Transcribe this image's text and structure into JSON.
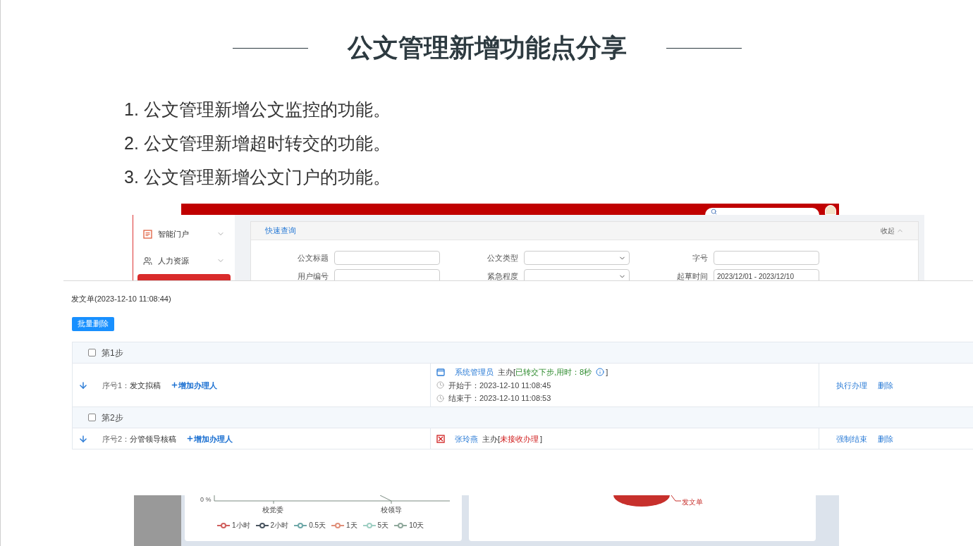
{
  "slide": {
    "title": "公文管理新增功能点分享",
    "points": [
      "1. 公文管理新增公文监控的功能。",
      "2. 公文管理新增超时转交的功能。",
      "3. 公文管理新增公文门户的功能。"
    ]
  },
  "portal_screenshot": {
    "sidebar": [
      {
        "label": "智能门户"
      },
      {
        "label": "人力资源"
      }
    ],
    "quick_query": {
      "title": "快速查询",
      "collapse": "收起"
    },
    "fields": [
      {
        "label": "公文标题",
        "kind": "text"
      },
      {
        "label": "公文类型",
        "kind": "select"
      },
      {
        "label": "字号",
        "kind": "text"
      },
      {
        "label": "用户编号",
        "kind": "text"
      },
      {
        "label": "紧急程度",
        "kind": "select"
      },
      {
        "label": "起草时间",
        "kind": "text",
        "value": "2023/12/01 - 2023/12/10"
      }
    ]
  },
  "flow": {
    "title": "发文单(2023-12-10 11:08:44)",
    "batch_delete": "批量删除",
    "steps": [
      {
        "label": "第1步",
        "checked": false,
        "seq": "序号1：",
        "name": "发文拟稿",
        "add": "增加办理人",
        "handler": "系统管理员",
        "role": "主办",
        "bracket_open": "[",
        "status": "已转交下步,用时：8秒",
        "bracket_close": "]",
        "kind": "done",
        "start": "开始于：2023-12-10 11:08:45",
        "end": "结束于：2023-12-10 11:08:53",
        "actions": [
          "执行办理",
          "删除"
        ]
      },
      {
        "label": "第2步",
        "checked": false,
        "seq": "序号2：",
        "name": "分管领导核稿",
        "add": "增加办理人",
        "handler": "张玲燕",
        "role": "主办",
        "bracket_open": "[",
        "status": "未接收办理",
        "bracket_close": "]",
        "kind": "pending",
        "actions": [
          "强制结束",
          "删除"
        ]
      }
    ]
  },
  "chart_panel": {
    "y_tick": "0 %",
    "categories": [
      "校党委",
      "校领导"
    ],
    "legend": [
      {
        "label": "1小时",
        "color": "#d0605e"
      },
      {
        "label": "2小时",
        "color": "#4a5560"
      },
      {
        "label": "0.5天",
        "color": "#6fa8a8"
      },
      {
        "label": "1天",
        "color": "#e0907a"
      },
      {
        "label": "5天",
        "color": "#9fcfc3"
      },
      {
        "label": "10天",
        "color": "#8fa89c"
      }
    ]
  },
  "pie_panel": {
    "label": "发文单"
  }
}
